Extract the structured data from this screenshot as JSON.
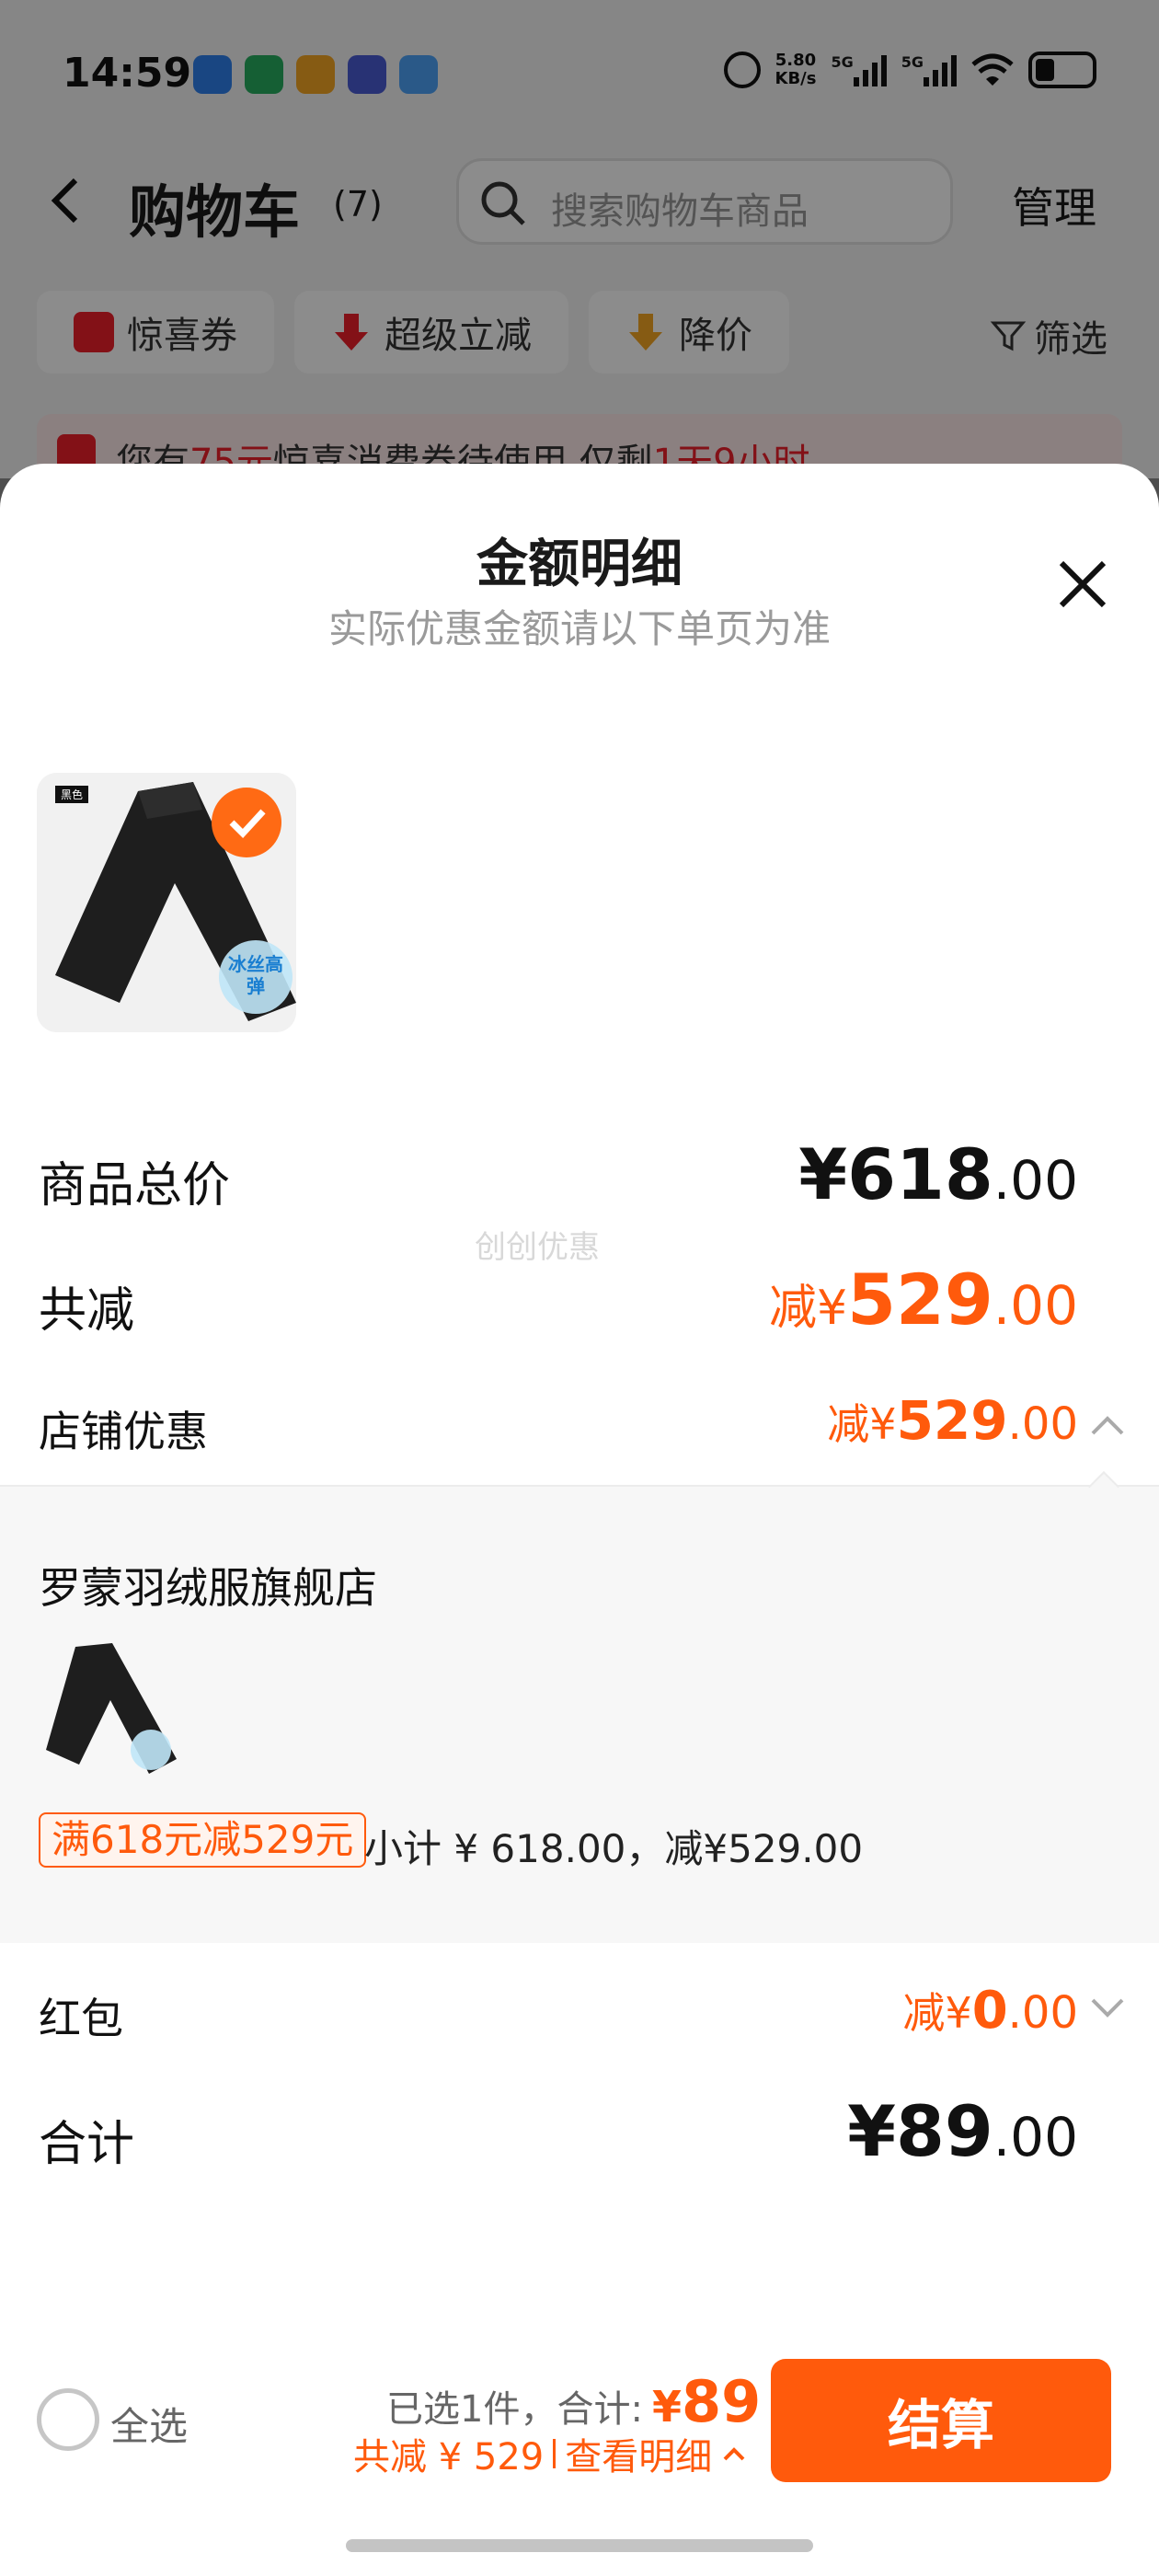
{
  "status_bar": {
    "time": "14:59",
    "net_speed_value": "5.80",
    "net_speed_unit": "KB/s",
    "sig1_label": "5G",
    "sig2_label": "5G",
    "battery_level": 0.2,
    "app_icon_colors": [
      "#2f80ed",
      "#27ae60",
      "#f5a623",
      "#4a5bd4",
      "#4da3f7"
    ]
  },
  "cart": {
    "title": "购物车",
    "count": "(7)",
    "search_placeholder": "搜索购物车商品",
    "manage": "管理",
    "chips": [
      {
        "label": "惊喜券",
        "icon": "coupon-icon",
        "color": "#ee1f2a"
      },
      {
        "label": "超级立减",
        "icon": "arrow-down-icon",
        "color": "#ee1f2a"
      },
      {
        "label": "降价",
        "icon": "price-drop-icon",
        "color": "#f5a623"
      }
    ],
    "filter": "筛选",
    "banner": {
      "p1": "您有",
      "amount": "75元",
      "p2": "惊喜消费券待使用 仅剩",
      "time": "1天9小时"
    }
  },
  "sheet": {
    "title": "金额明细",
    "subtitle": "实际优惠金额请以下单页为准",
    "product_tag": "黑色",
    "product_badge": "冰丝高弹",
    "total_label": "商品总价",
    "total_value": "¥618",
    "total_decimal": ".00",
    "discount_label": "共减",
    "discount_prefix": "减¥",
    "discount_value": "529",
    "discount_decimal": ".00",
    "watermark": "创创优惠",
    "store_label": "店铺优惠",
    "store_prefix": "减¥",
    "store_value": "529",
    "store_decimal": ".00",
    "store_name": "罗蒙羽绒服旗舰店",
    "promo_tag": "满618元减529元",
    "subtotal": "小计 ¥ 618.00，减¥529.00",
    "red_packet_label": "红包",
    "red_packet_prefix": "减¥",
    "red_packet_value": "0",
    "red_packet_decimal": ".00",
    "sum_label": "合计",
    "sum_value": "¥89",
    "sum_decimal": ".00"
  },
  "bottom": {
    "select_all": "全选",
    "selected": "已选1件，合计:",
    "yen": "¥",
    "amount": "89",
    "discount": "共减 ¥ 529",
    "view_detail": "查看明细",
    "checkout": "结算"
  },
  "colors": {
    "accent": "#ff5a0c",
    "red": "#ee1f2a"
  }
}
